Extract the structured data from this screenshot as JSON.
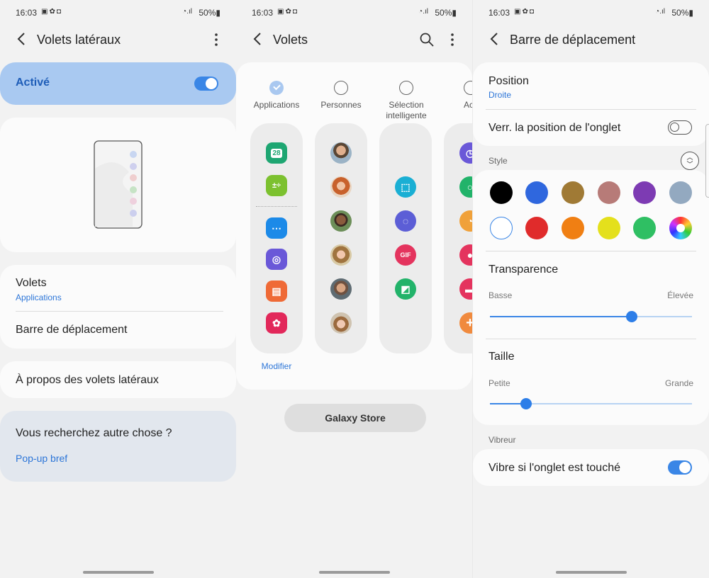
{
  "status": {
    "time": "16:03",
    "battery": "50%"
  },
  "screen1": {
    "title": "Volets latéraux",
    "active_label": "Activé",
    "items": [
      {
        "label": "Volets",
        "sub": "Applications"
      },
      {
        "label": "Barre de déplacement"
      }
    ],
    "about": "À propos des volets latéraux",
    "looking": {
      "question": "Vous recherchez autre chose ?",
      "link": "Pop-up bref"
    }
  },
  "screen2": {
    "title": "Volets",
    "tabs": [
      {
        "label": "Applications",
        "selected": true
      },
      {
        "label": "Personnes",
        "selected": false
      },
      {
        "label": "Sélection intelligente",
        "selected": false
      },
      {
        "label": "Acti",
        "selected": false
      }
    ],
    "modify": "Modifier",
    "calendar_day": "28",
    "store_button": "Galaxy Store"
  },
  "screen3": {
    "title": "Barre de déplacement",
    "position": {
      "label": "Position",
      "value": "Droite"
    },
    "lock_label": "Verr. la position de l'onglet",
    "style_label": "Style",
    "colors": [
      "#000000",
      "#2f67de",
      "#a07a35",
      "#b77b78",
      "#7d3bb3",
      "#93a9c0",
      "#ffffff",
      "#e02b2b",
      "#f07f13",
      "#e4e01c",
      "#2fbf63",
      "rainbow"
    ],
    "transparency": {
      "label": "Transparence",
      "min": "Basse",
      "max": "Élevée",
      "value": 0.7
    },
    "size": {
      "label": "Taille",
      "min": "Petite",
      "max": "Grande",
      "value": 0.18
    },
    "vibration_section": "Vibreur",
    "vibrate_label": "Vibre si l'onglet est touché"
  }
}
